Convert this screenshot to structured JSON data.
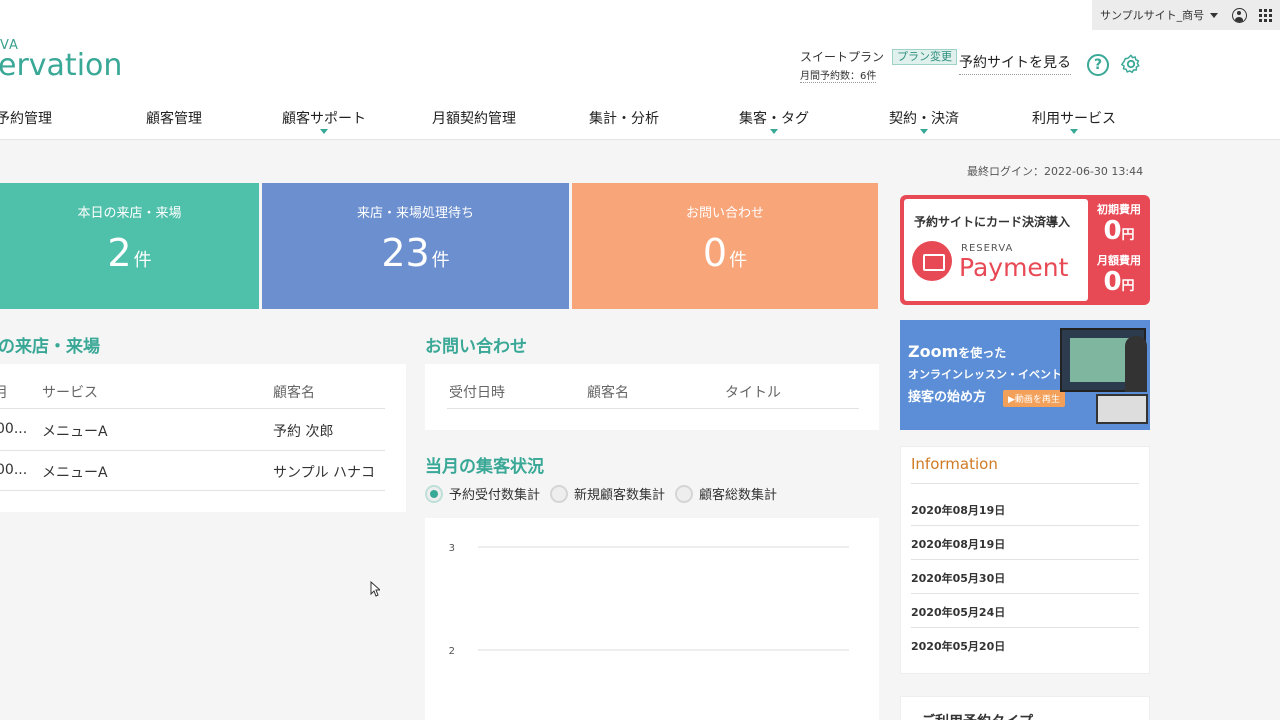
{
  "topbar": {
    "site_name": "サンプルサイト_商号"
  },
  "header": {
    "logo_top": "VA",
    "logo_main": "ervation",
    "plan_name": "スイートプラン",
    "plan_change": "プラン変更",
    "monthly_count": "月間予約数：6件",
    "view_site": "予約サイトを見る",
    "help": "?"
  },
  "nav": [
    {
      "label": "予約管理"
    },
    {
      "label": "顧客管理"
    },
    {
      "label": "顧客サポート"
    },
    {
      "label": "月額契約管理"
    },
    {
      "label": "集計・分析"
    },
    {
      "label": "集客・タグ"
    },
    {
      "label": "契約・決済"
    },
    {
      "label": "利用サービス"
    }
  ],
  "last_login": "最終ログイン：2022-06-30 13:44",
  "stats": [
    {
      "label": "本日の来店・来場",
      "value": "2",
      "unit": "件",
      "color": "#4fc0aa"
    },
    {
      "label": "来店・来場処理待ち",
      "value": "23",
      "unit": "件",
      "color": "#6b8fcf"
    },
    {
      "label": "お問い合わせ",
      "value": "0",
      "unit": "件",
      "color": "#f9a57a"
    }
  ],
  "promo": {
    "title": "予約サイトにカード決済導入",
    "brand": "RESERVA",
    "product": "Payment",
    "initial_label": "初期費用",
    "initial_value": "0",
    "monthly_label": "月額費用",
    "monthly_value": "0",
    "yen": "円"
  },
  "zoom": {
    "title": "Zoom",
    "title_suffix": "を使った",
    "line2": "オンラインレッスン・イベント・",
    "line3": "接客の始め方",
    "play": "▶動画を再生"
  },
  "visits": {
    "title": "の来店・来場",
    "headers": [
      "月",
      "サービス",
      "顧客名"
    ],
    "rows": [
      {
        "time": "00...",
        "service": "メニューA",
        "customer": "予約 次郎"
      },
      {
        "time": "00...",
        "service": "メニューA",
        "customer": "サンプル ハナコ"
      }
    ]
  },
  "inquiries": {
    "title": "お問い合わせ",
    "headers": [
      "受付日時",
      "顧客名",
      "タイトル"
    ]
  },
  "monthly": {
    "title": "当月の集客状況",
    "options": [
      "予約受付数集計",
      "新規顧客数集計",
      "顧客総数集計"
    ],
    "selected": 0
  },
  "chart_data": {
    "type": "line",
    "title": "",
    "y_ticks": [
      3,
      2
    ],
    "series": []
  },
  "information": {
    "title": "Information",
    "items": [
      "2020年08月19日",
      "2020年08月19日",
      "2020年05月30日",
      "2020年05月24日",
      "2020年05月20日"
    ]
  },
  "types_panel": {
    "title": "ご利用予約タイプ"
  }
}
